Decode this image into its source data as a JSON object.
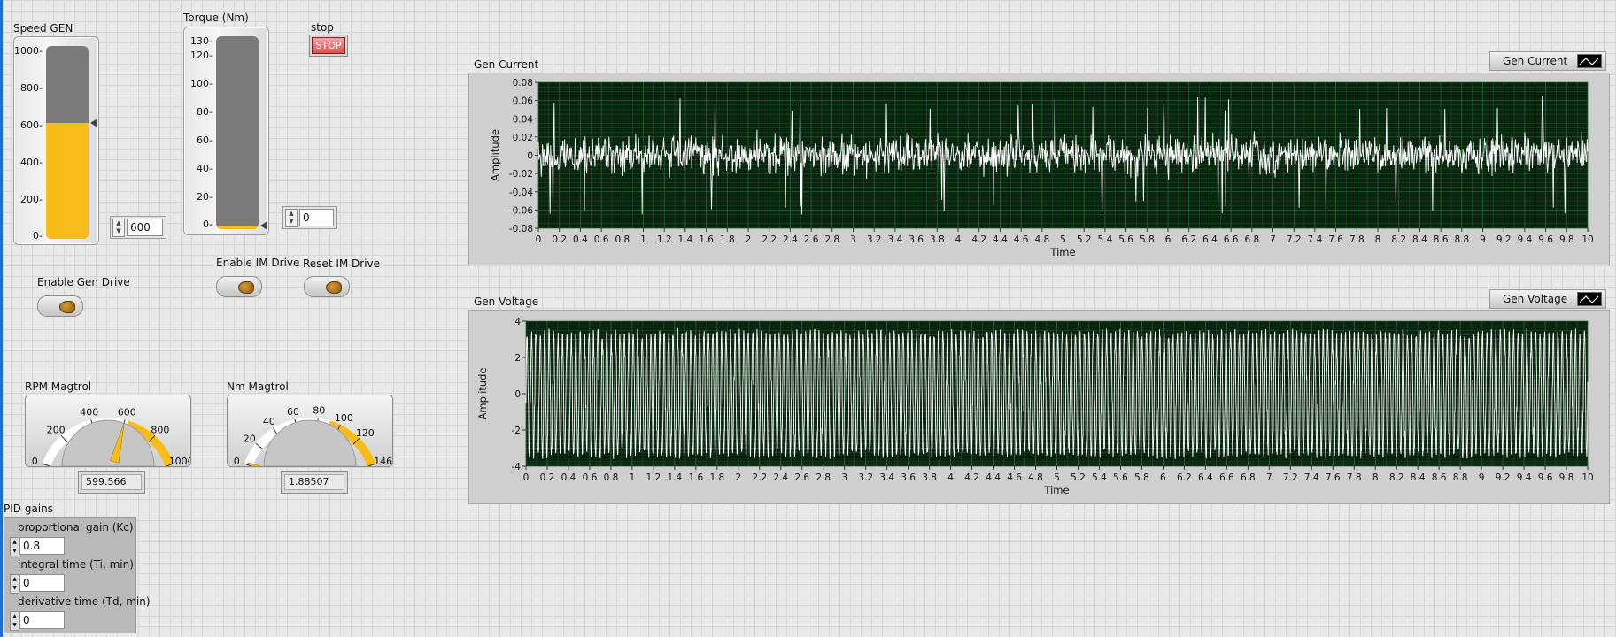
{
  "speed": {
    "label": "Speed  GEN",
    "ticks": [
      "1000-",
      "800-",
      "600-",
      "400-",
      "200-",
      "0-"
    ],
    "fraction": 0.6,
    "numeric_value": "600"
  },
  "torque": {
    "label": "Torque (Nm)",
    "ticks": [
      "130-",
      "120-",
      "100-",
      "80-",
      "60-",
      "40-",
      "20-",
      "0-"
    ],
    "fraction": 0.0,
    "numeric_value": "0"
  },
  "stop": {
    "label": "stop",
    "button": "STOP"
  },
  "drive": {
    "enable_gen": "Enable Gen Drive",
    "enable_im": "Enable IM Drive",
    "reset_im": "Reset IM Drive"
  },
  "rpm_gauge": {
    "label": "RPM Magtrol",
    "ticks": [
      "0",
      "200",
      "400",
      "600",
      "800",
      "1000"
    ],
    "value": 599.566,
    "readout": "599.566",
    "max": 1000
  },
  "nm_gauge": {
    "label": "Nm Magtrol",
    "ticks": [
      "0",
      "20",
      "40",
      "60",
      "80",
      "100",
      "120",
      "146"
    ],
    "value": 1.88507,
    "readout": "1.88507",
    "max": 146
  },
  "pid": {
    "title": "PID gains",
    "kc_label": "proportional gain (Kc)",
    "kc": "0.8",
    "ti_label": "integral time (Ti, min)",
    "ti": "0",
    "td_label": "derivative time (Td, min)",
    "td": "0"
  },
  "colors": {
    "accent": "#f7bb1a",
    "plot_bg": "#0b2310",
    "grid": "#1e6a2a",
    "trace": "#ffffff"
  },
  "chart_data": [
    {
      "type": "line",
      "title": "Gen Current",
      "legend": "Gen Current",
      "xlabel": "Time",
      "ylabel": "Amplitude",
      "xlim": [
        0,
        10
      ],
      "ylim": [
        -0.08,
        0.08
      ],
      "xticks": [
        "0",
        "0.2",
        "0.4",
        "0.6",
        "0.8",
        "1",
        "1.2",
        "1.4",
        "1.6",
        "1.8",
        "2",
        "2.2",
        "2.4",
        "2.6",
        "2.8",
        "3",
        "3.2",
        "3.4",
        "3.6",
        "3.8",
        "4",
        "4.2",
        "4.4",
        "4.6",
        "4.8",
        "5",
        "5.2",
        "5.4",
        "5.6",
        "5.8",
        "6",
        "6.2",
        "6.4",
        "6.6",
        "6.8",
        "7",
        "7.2",
        "7.4",
        "7.6",
        "7.8",
        "8",
        "8.2",
        "8.4",
        "8.6",
        "8.8",
        "9",
        "9.2",
        "9.4",
        "9.6",
        "9.8",
        "10"
      ],
      "yticks": [
        "0.08",
        "0.06",
        "0.04",
        "0.02",
        "0",
        "-0.02",
        "-0.04",
        "-0.06",
        "-0.08"
      ],
      "signal": {
        "shape": "noise",
        "mean": 0,
        "amplitude": 0.025,
        "peak": 0.065
      },
      "grid": true
    },
    {
      "type": "line",
      "title": "Gen Voltage",
      "legend": "Gen Voltage",
      "xlabel": "Time",
      "ylabel": "Amplitude",
      "xlim": [
        0,
        10
      ],
      "ylim": [
        -4,
        4
      ],
      "xticks": [
        "0",
        "0.2",
        "0.4",
        "0.6",
        "0.8",
        "1",
        "1.2",
        "1.4",
        "1.6",
        "1.8",
        "2",
        "2.2",
        "2.4",
        "2.6",
        "2.8",
        "3",
        "3.2",
        "3.4",
        "3.6",
        "3.8",
        "4",
        "4.2",
        "4.4",
        "4.6",
        "4.8",
        "5",
        "5.2",
        "5.4",
        "5.6",
        "5.8",
        "6",
        "6.2",
        "6.4",
        "6.6",
        "6.8",
        "7",
        "7.2",
        "7.4",
        "7.6",
        "7.8",
        "8",
        "8.2",
        "8.4",
        "8.6",
        "8.8",
        "9",
        "9.2",
        "9.4",
        "9.6",
        "9.8",
        "10"
      ],
      "yticks": [
        "4",
        "2",
        "0",
        "-2",
        "-4"
      ],
      "signal": {
        "shape": "sine",
        "amplitude": 3.6,
        "cycles": 240
      },
      "grid": true
    }
  ]
}
